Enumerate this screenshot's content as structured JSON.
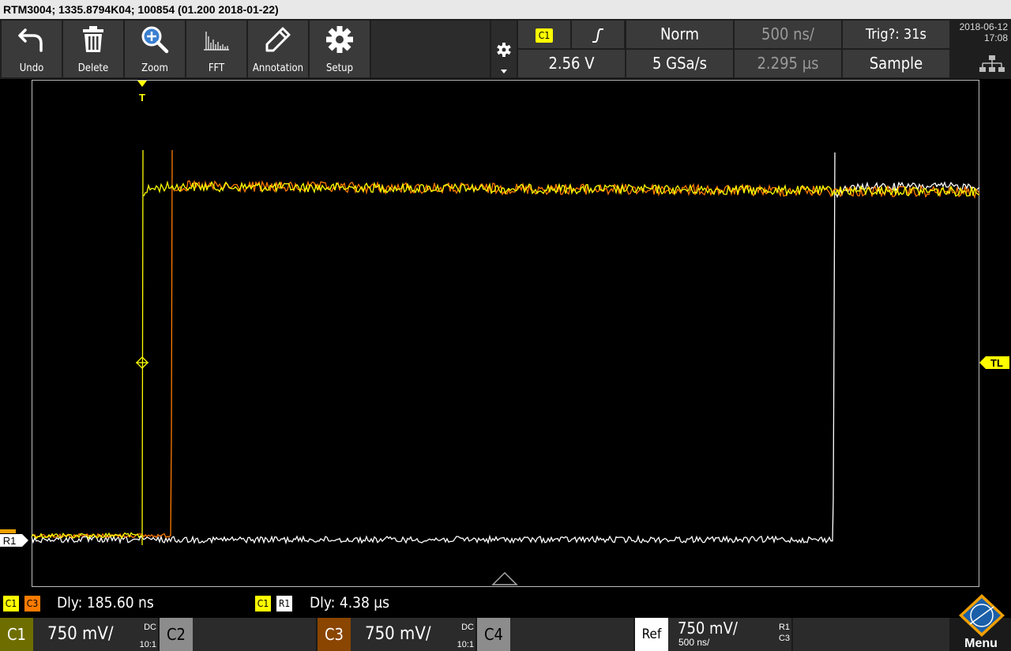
{
  "title": "RTM3004; 1335.8794K04; 100854 (01.200 2018-01-22)",
  "toolbar": {
    "undo": "Undo",
    "delete": "Delete",
    "zoom": "Zoom",
    "fft": "FFT",
    "annotation": "Annotation",
    "setup": "Setup"
  },
  "trigger_panel": {
    "source": "C1",
    "mode": "Norm",
    "timebase": "500 ns/",
    "trig_status": "Trig?: 31s",
    "level": "2.56 V",
    "sample_rate": "5 GSa/s",
    "position": "2.295 µs",
    "acq_mode": "Sample"
  },
  "datetime": {
    "date": "2018-06-12",
    "time": "17:08"
  },
  "markers": {
    "trigger": "T",
    "trigger_level": "TL",
    "ref": "R1"
  },
  "measurements": [
    {
      "a": "C1",
      "b": "C3",
      "label": "Dly: 185.60 ns"
    },
    {
      "a": "C1",
      "b": "R1",
      "label": "Dly: 4.38 µs"
    }
  ],
  "channels": {
    "c1": {
      "name": "C1",
      "scale": "750 mV/",
      "coupling": "DC",
      "probe": "10:1"
    },
    "c2": {
      "name": "C2"
    },
    "c3": {
      "name": "C3",
      "scale": "750 mV/",
      "coupling": "DC",
      "probe": "10:1"
    },
    "c4": {
      "name": "C4"
    },
    "ref": {
      "name": "Ref",
      "scale": "750 mV/",
      "time": "500 ns/",
      "r": "R1",
      "src": "C3"
    }
  },
  "menu": "Menu",
  "colors": {
    "c1": "#ffff00",
    "c3": "#ff7b00",
    "ref": "#ffffff",
    "accent": "#f0a000"
  }
}
